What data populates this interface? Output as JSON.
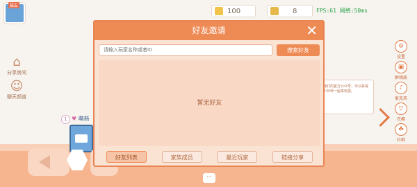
{
  "hud": {
    "avatar_badge": "猫友",
    "coins": "100",
    "gems": "8",
    "fps": "FPS:61 网络:50ms"
  },
  "left_tools": [
    {
      "label": "分享房间",
      "icon": "home-share-icon"
    },
    {
      "label": "聊天频道",
      "icon": "chat-person-icon"
    }
  ],
  "right_tools": [
    {
      "label": "设置",
      "icon": "settings-icon"
    },
    {
      "label": "群相册",
      "icon": "photo-icon"
    },
    {
      "label": "麦克风",
      "icon": "mic-icon"
    },
    {
      "label": "衣橱",
      "icon": "shirt-icon"
    },
    {
      "label": "社群",
      "icon": "community-icon"
    }
  ],
  "hint_text": "我们的官方公众号，可以获得小伙伴一起来玩耍。",
  "player": {
    "level": "1",
    "name": "萌新"
  },
  "modal": {
    "title": "好友邀请",
    "close": "✕",
    "search_placeholder": "请输入玩家名称或者ID",
    "search_button": "搜索好友",
    "empty_text": "暂无好友",
    "tabs": [
      "好友列表",
      "家族成员",
      "最近玩家",
      "链接分享"
    ]
  },
  "chat_button": "···",
  "colors": {
    "accent": "#ee8a54",
    "panel": "#fbe3d4"
  }
}
